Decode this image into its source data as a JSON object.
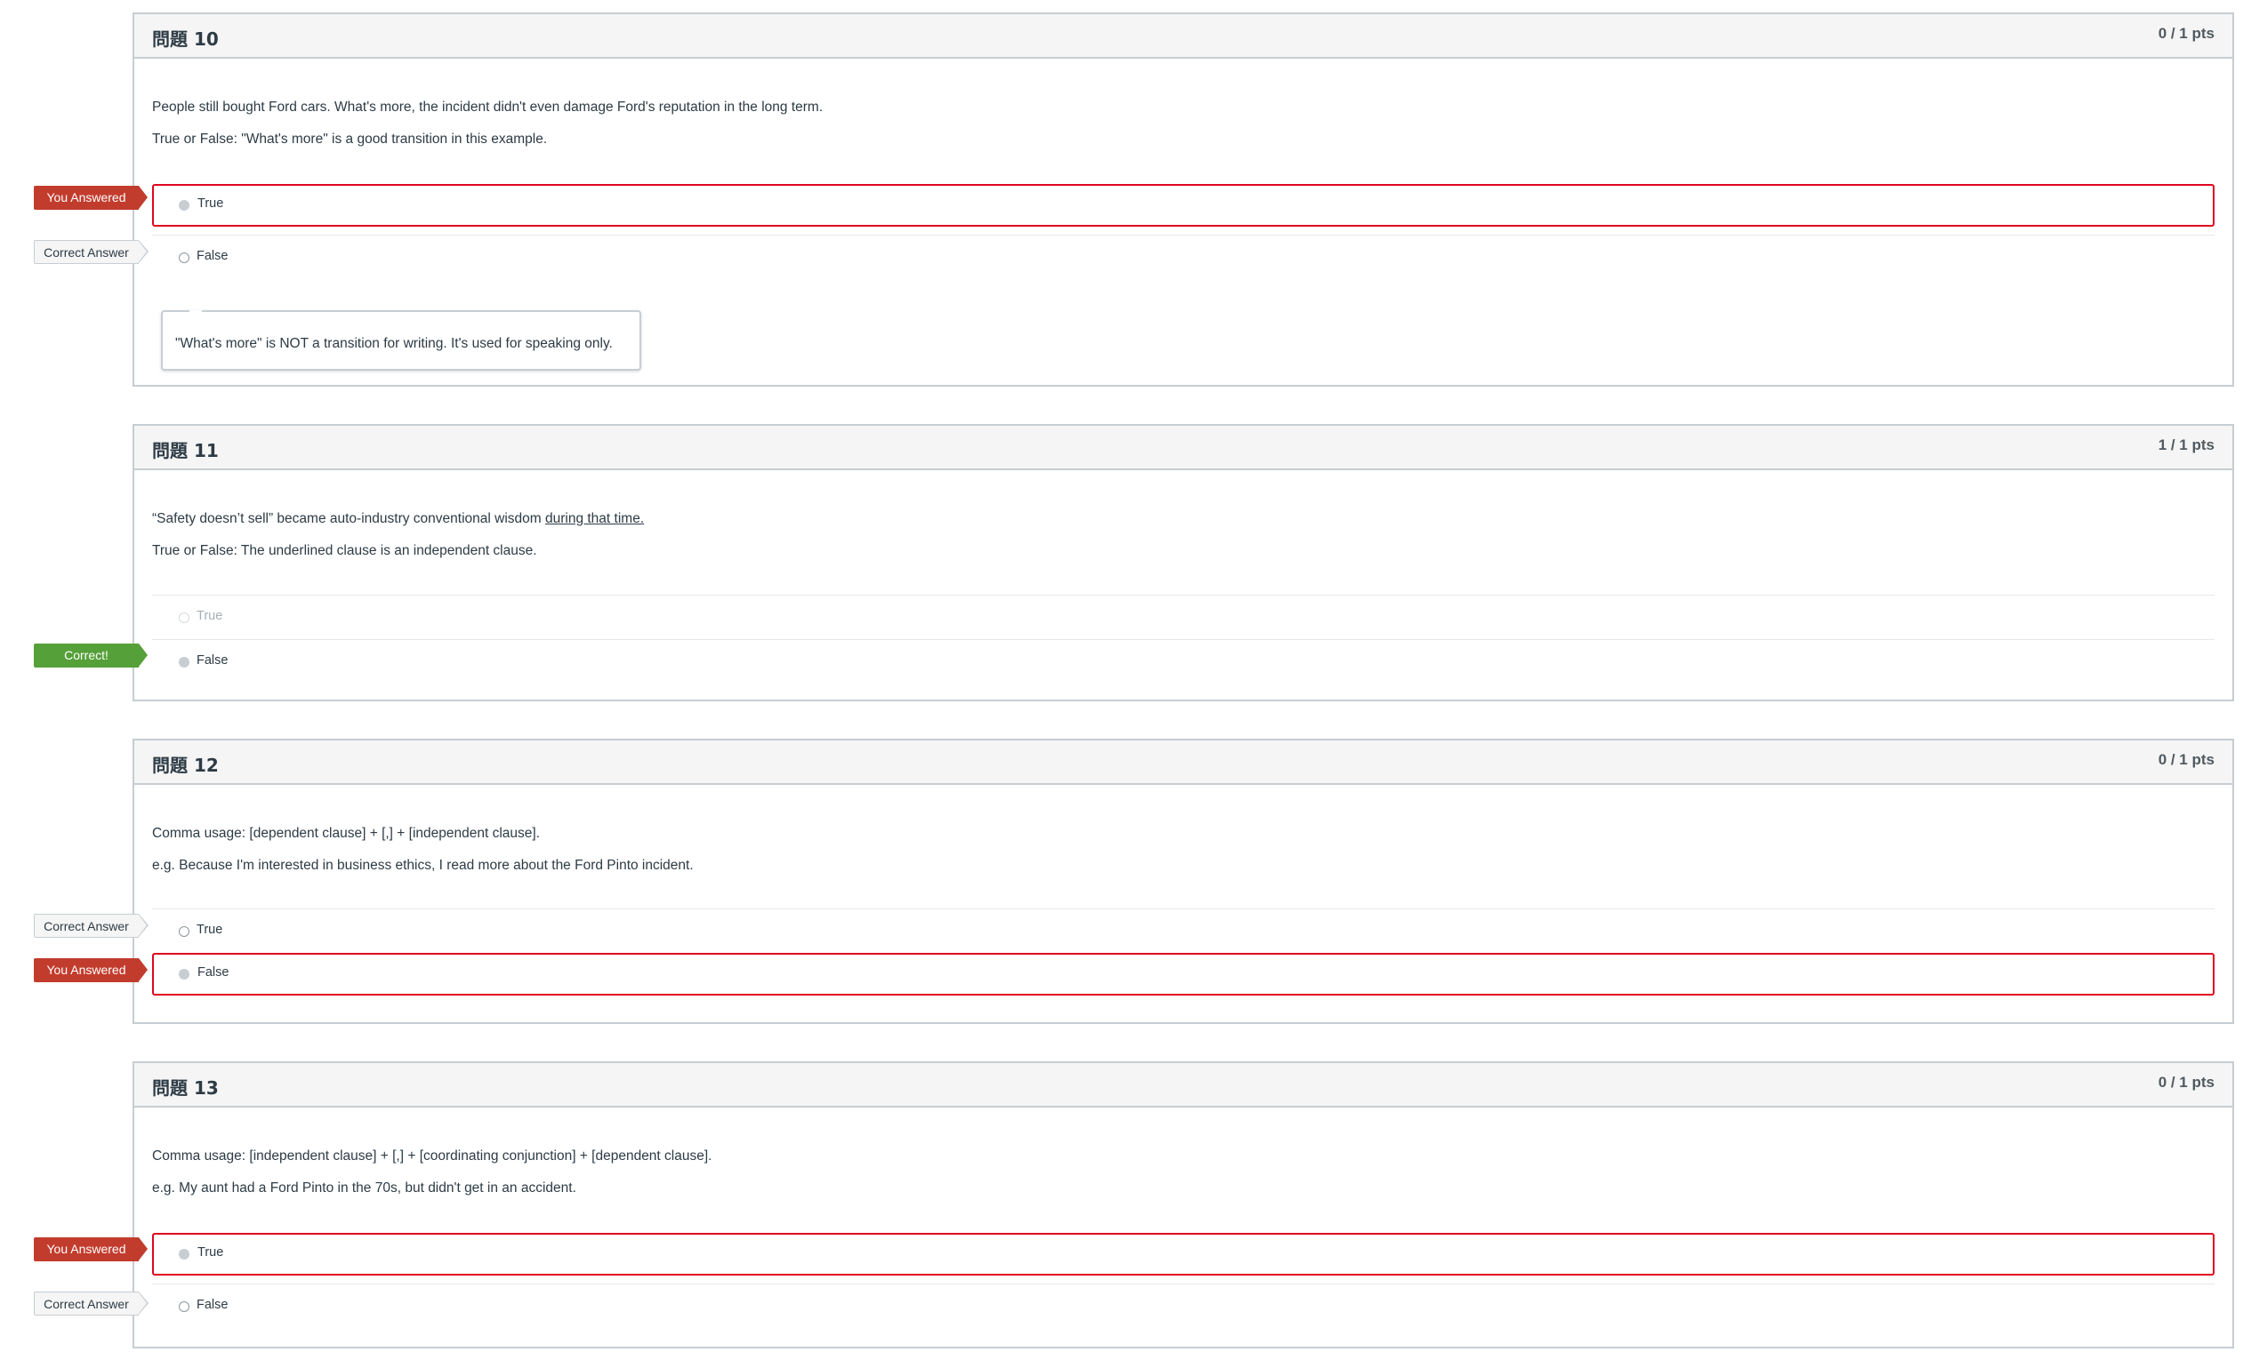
{
  "questions": [
    {
      "title": "問題 10",
      "points": "0 / 1 pts",
      "lines": [
        "People still bought Ford cars. What's more, the incident didn't even damage Ford's reputation in the long term.",
        "True or False: \"What's more\" is a good transition in this example."
      ],
      "answers": [
        {
          "label": "True",
          "state": "you-answered",
          "flag": "You Answered"
        },
        {
          "label": "False",
          "state": "correct-answer",
          "flag": "Correct Answer"
        }
      ],
      "comment": "\"What's more\" is NOT a transition for writing. It's used for speaking only."
    },
    {
      "title": "問題 11",
      "points": "1 / 1 pts",
      "lines": [
        "“Safety doesn’t sell” became auto-industry conventional wisdom ",
        "True or False: The underlined clause is an independent clause."
      ],
      "underlined": "during that time.",
      "answers": [
        {
          "label": "True",
          "state": "unselected"
        },
        {
          "label": "False",
          "state": "correct",
          "flag": "Correct!"
        }
      ]
    },
    {
      "title": "問題 12",
      "points": "0 / 1 pts",
      "lines": [
        "Comma usage: [dependent clause] + [,] + [independent clause].",
        "e.g. Because I'm interested in business ethics, I read more about the Ford Pinto incident."
      ],
      "answers": [
        {
          "label": "True",
          "state": "correct-answer",
          "flag": "Correct Answer"
        },
        {
          "label": "False",
          "state": "you-answered",
          "flag": "You Answered"
        }
      ]
    },
    {
      "title": "問題 13",
      "points": "0 / 1 pts",
      "lines": [
        "Comma usage: [independent clause] + [,] + [coordinating conjunction] + [dependent clause].",
        "e.g. My aunt had a Ford Pinto in the 70s, but didn't get in an accident."
      ],
      "answers": [
        {
          "label": "True",
          "state": "you-answered",
          "flag": "You Answered"
        },
        {
          "label": "False",
          "state": "correct-answer",
          "flag": "Correct Answer"
        }
      ]
    }
  ],
  "colors": {
    "wrong_border": "#e0061f",
    "you_answered_flag": "#c23c2d",
    "correct_flag": "#55a038",
    "header_bg": "#f5f5f5",
    "border": "#c7cdd1"
  }
}
